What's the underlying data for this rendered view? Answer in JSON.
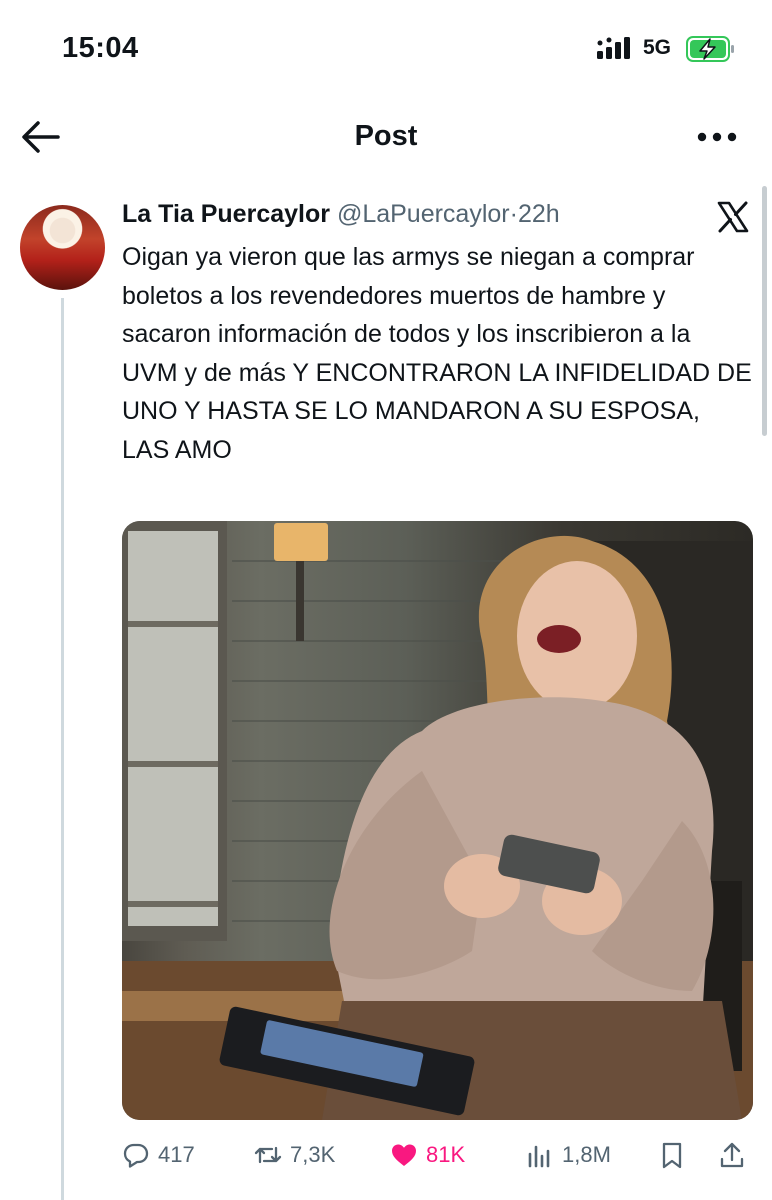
{
  "status_bar": {
    "time": "15:04",
    "network": "5G",
    "icons": [
      "signal-icon",
      "battery-charging-icon"
    ],
    "battery_color": "#34c759"
  },
  "nav": {
    "title": "Post",
    "back_icon": "arrow-left-icon",
    "more_icon": "more-horizontal-icon"
  },
  "tweet": {
    "author_name": "La Tia Puercaylor",
    "handle": "@LaPuercaylor",
    "separator": "·",
    "time_ago": "22h",
    "platform_icon": "x-logo-icon",
    "text": "Oigan ya vieron que las armys se niegan a comprar boletos a los revendedores muertos de hambre y sacaron información de todos y los inscribieron a la UVM y de más Y ENCONTRARON LA INFIDELIDAD DE UNO Y HASTA SE LO MANDARON A SU ESPOSA, LAS AMO",
    "media_icon": "photo-laughing-woman"
  },
  "actions": {
    "replies": "417",
    "reposts": "7,3K",
    "likes": "81K",
    "views": "1,8M",
    "liked": true,
    "like_color": "#f91880",
    "icons": [
      "reply-icon",
      "repost-icon",
      "heart-icon",
      "views-icon",
      "bookmark-icon",
      "share-icon"
    ]
  }
}
